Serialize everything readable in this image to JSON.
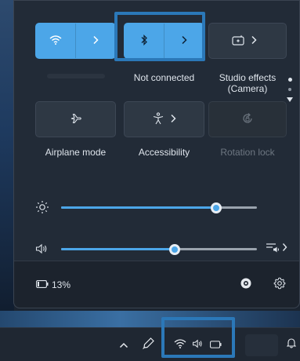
{
  "quick_settings": {
    "tiles": [
      {
        "name": "wifi",
        "label": "",
        "state": "on",
        "icon": "wifi-icon",
        "expand_icon": "chevron-right-icon"
      },
      {
        "name": "bluetooth",
        "label": "Not connected",
        "state": "on",
        "icon": "bluetooth-icon",
        "expand_icon": "chevron-right-icon"
      },
      {
        "name": "studio-effects",
        "label": "Studio effects\n(Camera)",
        "state": "off",
        "icon": "studio-effects-icon",
        "expand_icon": "chevron-right-icon"
      },
      {
        "name": "airplane-mode",
        "label": "Airplane mode",
        "state": "off",
        "icon": "airplane-icon"
      },
      {
        "name": "accessibility",
        "label": "Accessibility",
        "state": "off",
        "icon": "accessibility-icon",
        "expand_icon": "chevron-right-icon"
      },
      {
        "name": "rotation-lock",
        "label": "Rotation lock",
        "state": "disabled",
        "icon": "rotation-lock-icon"
      }
    ],
    "brightness": {
      "icon": "brightness-icon",
      "level": 0.79
    },
    "volume": {
      "icon": "speaker-icon",
      "level": 0.58,
      "output_icon": "audio-output-icon"
    },
    "battery": {
      "icon": "battery-icon",
      "text": "13%"
    },
    "footer_icons": [
      "battery-saver-icon",
      "settings-gear-icon"
    ],
    "pages": {
      "count": 2,
      "current": 1
    }
  },
  "taskbar": {
    "icons": [
      "chevron-up-icon",
      "pen-icon",
      "wifi-icon",
      "speaker-icon",
      "battery-icon",
      "notification-bell-icon"
    ]
  },
  "colors": {
    "accent": "#4ca6e8",
    "highlight": "#2b78b8",
    "panel": "#222b37"
  }
}
